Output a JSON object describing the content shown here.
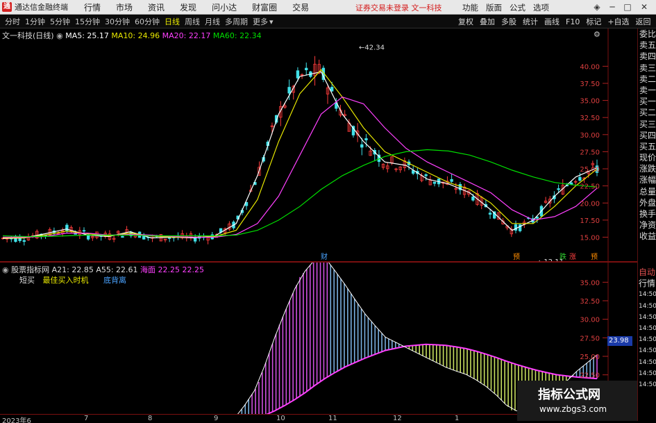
{
  "app": {
    "logo": "通",
    "title": "通达信金融终端",
    "menu": [
      "行情",
      "市场",
      "资讯",
      "发现",
      "问小达",
      "财富圈",
      "交易"
    ],
    "notice": "证券交易未登录  文一科技",
    "right_menu": [
      "功能",
      "版面",
      "公式",
      "选项"
    ]
  },
  "toolbar": {
    "periods": [
      "分时",
      "1分钟",
      "5分钟",
      "15分钟",
      "30分钟",
      "60分钟",
      "日线",
      "周线",
      "月线",
      "多周期",
      "更多"
    ],
    "active_period": "日线",
    "tools": [
      "复权",
      "叠加",
      "多股",
      "统计",
      "画线",
      "F10",
      "标记",
      "+自选",
      "返回"
    ]
  },
  "main_legend": {
    "title": "文一科技(日线)",
    "ma5": "MA5: 25.17",
    "ma10": "MA10: 24.96",
    "ma20": "MA20: 22.17",
    "ma60": "MA60: 22.34",
    "colors": {
      "ma5": "#ffffff",
      "ma10": "#e8e800",
      "ma20": "#ff40ff",
      "ma60": "#00e000"
    }
  },
  "indicator_legend": {
    "title": "股票指标网",
    "a21": "A21: 22.85",
    "a55": "A55: 22.61",
    "haimian": "海面",
    "values": "22.25  22.25",
    "line2_a": "短买",
    "line2_b": "最佳买入时机",
    "line2_c": "底背离"
  },
  "side_tabs": [
    "委比",
    "卖五",
    "卖四",
    "卖三",
    "卖二",
    "卖一",
    "买一",
    "买二",
    "买三",
    "买四",
    "买五",
    "现价",
    "涨跌",
    "涨幅",
    "总量",
    "外盘",
    "换手",
    "净资",
    "收益"
  ],
  "side_tabs2": [
    "自动",
    "行情",
    "14:50",
    "14:50",
    "14:50",
    "14:50",
    "14:50",
    "14:50",
    "14:50",
    "14:50",
    "14:50",
    "14:50",
    "14:50",
    "14:50"
  ],
  "price_axis": [
    "40.00",
    "37.50",
    "35.00",
    "32.50",
    "30.00",
    "27.50",
    "25.00",
    "22.50",
    "20.00",
    "17.50",
    "15.00"
  ],
  "ind_axis": [
    "35.00",
    "32.50",
    "30.00",
    "27.50",
    "25.00",
    "22.50",
    "20.00"
  ],
  "ind_current": "23.98",
  "annotations": {
    "high": "42.34",
    "low": "12.11",
    "marks": [
      "财",
      "预",
      "跌",
      "涨",
      "预"
    ]
  },
  "time_axis": [
    "2023年6",
    "7",
    "8",
    "9",
    "10",
    "11",
    "12",
    "1"
  ],
  "watermark": {
    "line1": "指标公式网",
    "line2": "www.zbgs3.com"
  },
  "chart_data": {
    "type": "line",
    "title": "文一科技(日线)",
    "ylim": [
      12,
      44
    ],
    "series": [
      {
        "name": "MA5",
        "values": [
          14.8,
          14.9,
          15.5,
          16.2,
          15.3,
          15.1,
          15.8,
          14.9,
          15.0,
          14.9,
          15.2,
          17.0,
          24.0,
          33.0,
          38.5,
          39.2,
          33.0,
          29.0,
          26.0,
          25.5,
          23.5,
          22.8,
          21.5,
          19.0,
          16.0,
          17.5,
          21.0,
          23.8,
          25.17
        ]
      },
      {
        "name": "MA10",
        "values": [
          14.9,
          14.9,
          15.3,
          15.9,
          15.5,
          15.2,
          15.6,
          15.2,
          15.0,
          15.0,
          15.1,
          16.0,
          20.5,
          29.0,
          36.0,
          39.5,
          35.5,
          31.0,
          27.5,
          26.0,
          24.5,
          23.0,
          22.0,
          20.0,
          17.0,
          17.0,
          19.5,
          22.5,
          24.96
        ]
      },
      {
        "name": "MA20",
        "values": [
          15.0,
          15.0,
          15.1,
          15.6,
          15.6,
          15.3,
          15.4,
          15.3,
          15.1,
          15.0,
          15.0,
          15.4,
          17.0,
          21.0,
          27.0,
          33.0,
          35.5,
          34.5,
          31.0,
          28.0,
          26.0,
          24.5,
          23.0,
          21.5,
          19.0,
          17.5,
          18.0,
          19.5,
          22.17
        ]
      },
      {
        "name": "MA60",
        "values": [
          15.2,
          15.1,
          15.1,
          15.2,
          15.3,
          15.3,
          15.3,
          15.2,
          15.2,
          15.2,
          15.2,
          15.3,
          16.0,
          17.5,
          19.5,
          22.0,
          24.0,
          25.5,
          26.8,
          27.5,
          27.8,
          27.6,
          27.0,
          26.0,
          24.8,
          23.8,
          23.0,
          22.6,
          22.34
        ]
      }
    ]
  }
}
